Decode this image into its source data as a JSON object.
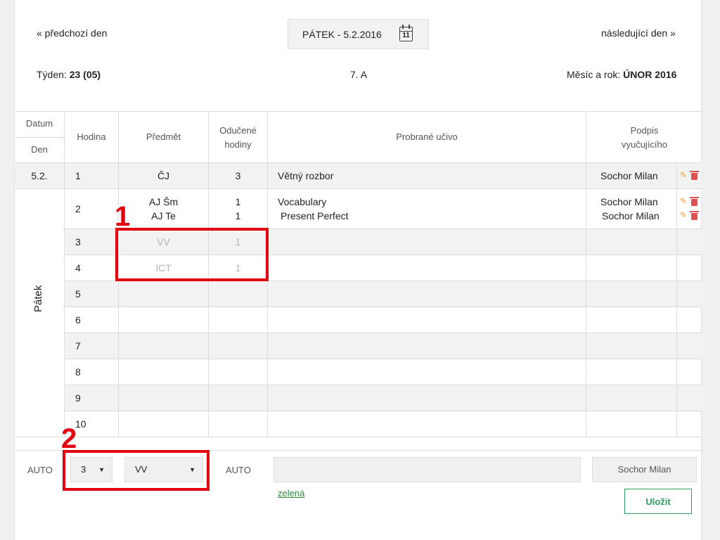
{
  "header": {
    "prev_day": "« předchozí den",
    "next_day": "následující den »",
    "current_date": "PÁTEK - 5.2.2016",
    "calendar_day": "11",
    "week_label": "Týden:",
    "week_value": "23 (05)",
    "class_name": "7. A",
    "month_label": "Měsíc a rok:",
    "month_value": "ÚNOR 2016"
  },
  "table": {
    "headers": {
      "datum": "Datum",
      "den": "Den",
      "hodina": "Hodina",
      "predmet": "Předmět",
      "oducene_1": "Odučené",
      "oducene_2": "hodiny",
      "ucivo": "Probrané učivo",
      "podpis_1": "Podpis",
      "podpis_2": "vyučujícího"
    },
    "date": "5.2.",
    "day": "Pátek",
    "rows": [
      {
        "hour": "1",
        "subject": "ČJ",
        "count": "3",
        "topic": "Větný rozbor",
        "teacher": "Sochor Milan"
      },
      {
        "hour": "2",
        "subject": "AJ Šm",
        "subject2": "AJ Te",
        "count": "1",
        "count2": "1",
        "topic": "Vocabulary",
        "topic2": "Present Perfect",
        "teacher": "Sochor Milan",
        "teacher2": "Sochor Milan"
      },
      {
        "hour": "3",
        "subject": "VV",
        "count": "1"
      },
      {
        "hour": "4",
        "subject": "ICT",
        "count": "1"
      },
      {
        "hour": "5"
      },
      {
        "hour": "6"
      },
      {
        "hour": "7"
      },
      {
        "hour": "8"
      },
      {
        "hour": "9"
      },
      {
        "hour": "10"
      }
    ]
  },
  "form": {
    "auto_label_1": "AUTO",
    "hour_select": "3",
    "subject_select": "VV",
    "auto_label_2": "AUTO",
    "topic_value": "",
    "teacher_value": "Sochor Milan",
    "color_link": "zelená",
    "save_label": "Uložit"
  },
  "annotations": {
    "label_1": "1",
    "label_2": "2"
  },
  "colors": {
    "accent_red": "#e3000f",
    "save_green": "#2e9e5e",
    "link_green": "#2e8b3e",
    "edit_orange": "#e9a23b",
    "delete_red": "#e05050"
  }
}
